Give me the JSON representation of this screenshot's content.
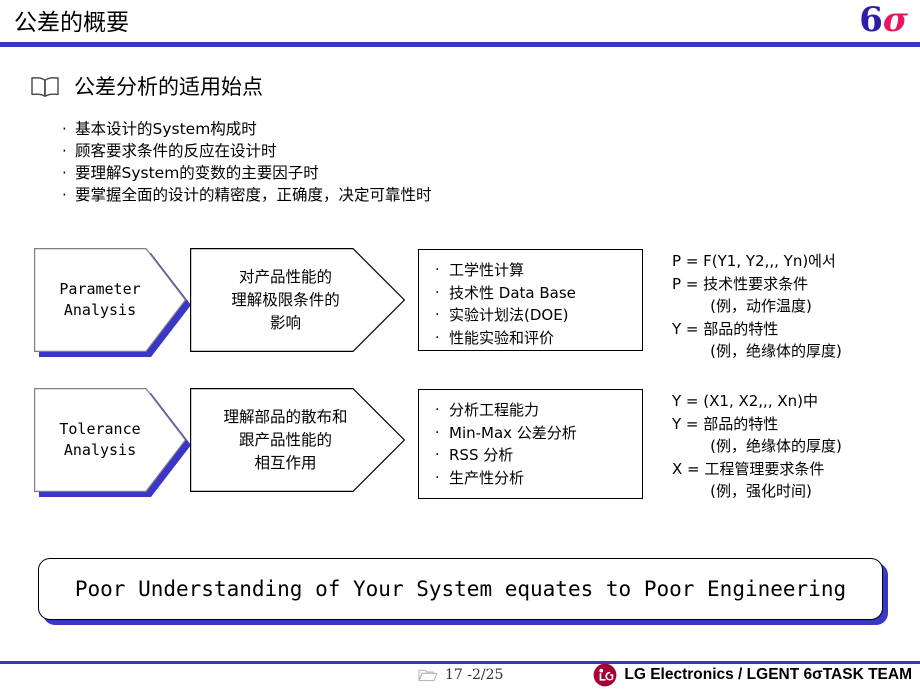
{
  "header": {
    "title": "公差的概要",
    "logo_six": "6",
    "logo_sigma": "σ"
  },
  "section": {
    "icon": "open-book-icon",
    "heading": "公差分析的适用始点",
    "bullets": [
      "基本设计的System构成时",
      "顾客要求条件的反应在设计时",
      "要理解System的变数的主要因子时",
      "要掌握全面的设计的精密度，正确度，决定可靠性时"
    ]
  },
  "flow": {
    "rows": [
      {
        "stage_line1": "Parameter",
        "stage_line2": "Analysis",
        "description_lines": [
          "对产品性能的",
          "理解极限条件的",
          "影响"
        ],
        "methods": [
          "工学性计算",
          "技术性 Data Base",
          "实验计划法(DOE)",
          "性能实验和评价"
        ],
        "equations": [
          "P = F(Y1, Y2,,, Yn)에서",
          "P = 技术性要求条件",
          "        (例，动作温度)",
          "Y = 部品的特性",
          "        (例，绝缘体的厚度)"
        ]
      },
      {
        "stage_line1": "Tolerance",
        "stage_line2": "Analysis",
        "description_lines": [
          "理解部品的散布和",
          "跟产品性能的",
          "相互作用"
        ],
        "methods": [
          "分析工程能力",
          "Min-Max 公差分析",
          "RSS 分析",
          "生产性分析"
        ],
        "equations": [
          "Y = (X1, X2,,, Xn)中",
          "Y = 部品的特性",
          "        (例，绝缘体的厚度)",
          "X = 工程管理要求条件",
          "        (例，强化时间)"
        ]
      }
    ]
  },
  "banner": {
    "text": "Poor Understanding of Your System equates to Poor Engineering"
  },
  "footer": {
    "page_label": "17 -2/25",
    "brand": "LG Electronics / LGENT 6σTASK TEAM"
  },
  "colors": {
    "accent_blue": "#3a36c8",
    "logo_six": "#2d1ea8",
    "logo_sigma": "#e8175d",
    "lg_red": "#a50034"
  }
}
